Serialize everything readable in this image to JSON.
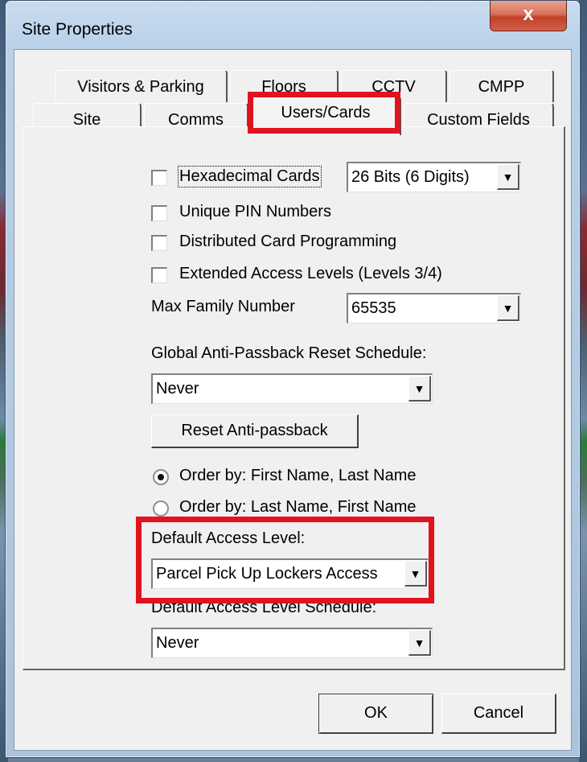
{
  "window": {
    "title": "Site Properties",
    "close_label": "x"
  },
  "tabs": {
    "row1": [
      {
        "label": "Visitors & Parking"
      },
      {
        "label": "Floors"
      },
      {
        "label": "CCTV"
      },
      {
        "label": "CMPP"
      }
    ],
    "row2": [
      {
        "label": "Site"
      },
      {
        "label": "Comms"
      },
      {
        "label": "Users/Cards"
      },
      {
        "label": "Custom Fields"
      }
    ],
    "active": "Users/Cards"
  },
  "users_cards": {
    "hex_cards": {
      "label": "Hexadecimal Cards",
      "checked": false
    },
    "bits_combo": {
      "value": "26 Bits (6 Digits)"
    },
    "unique_pin": {
      "label": "Unique PIN Numbers",
      "checked": false
    },
    "distributed": {
      "label": "Distributed Card Programming",
      "checked": false
    },
    "extended": {
      "label": "Extended Access Levels (Levels 3/4)",
      "checked": false
    },
    "max_family": {
      "label": "Max Family Number",
      "value": "65535"
    },
    "anti_passback": {
      "label": "Global Anti-Passback Reset Schedule:",
      "value": "Never"
    },
    "reset_button": "Reset Anti-passback",
    "order_first": {
      "label": "Order by: First Name, Last Name",
      "selected": true
    },
    "order_last": {
      "label": "Order by: Last Name, First Name",
      "selected": false
    },
    "default_access": {
      "label": "Default Access Level:",
      "value": "Parcel Pick Up Lockers Access"
    },
    "default_schedule": {
      "label": "Default Access Level Schedule:",
      "value": "Never"
    }
  },
  "footer": {
    "ok": "OK",
    "cancel": "Cancel"
  },
  "colors": {
    "highlight": "#e0131f",
    "close_button": "#c8442f",
    "dialog_bg": "#f0f0f0"
  },
  "icons": {
    "dropdown": "chevron-down-icon",
    "close": "close-icon"
  }
}
